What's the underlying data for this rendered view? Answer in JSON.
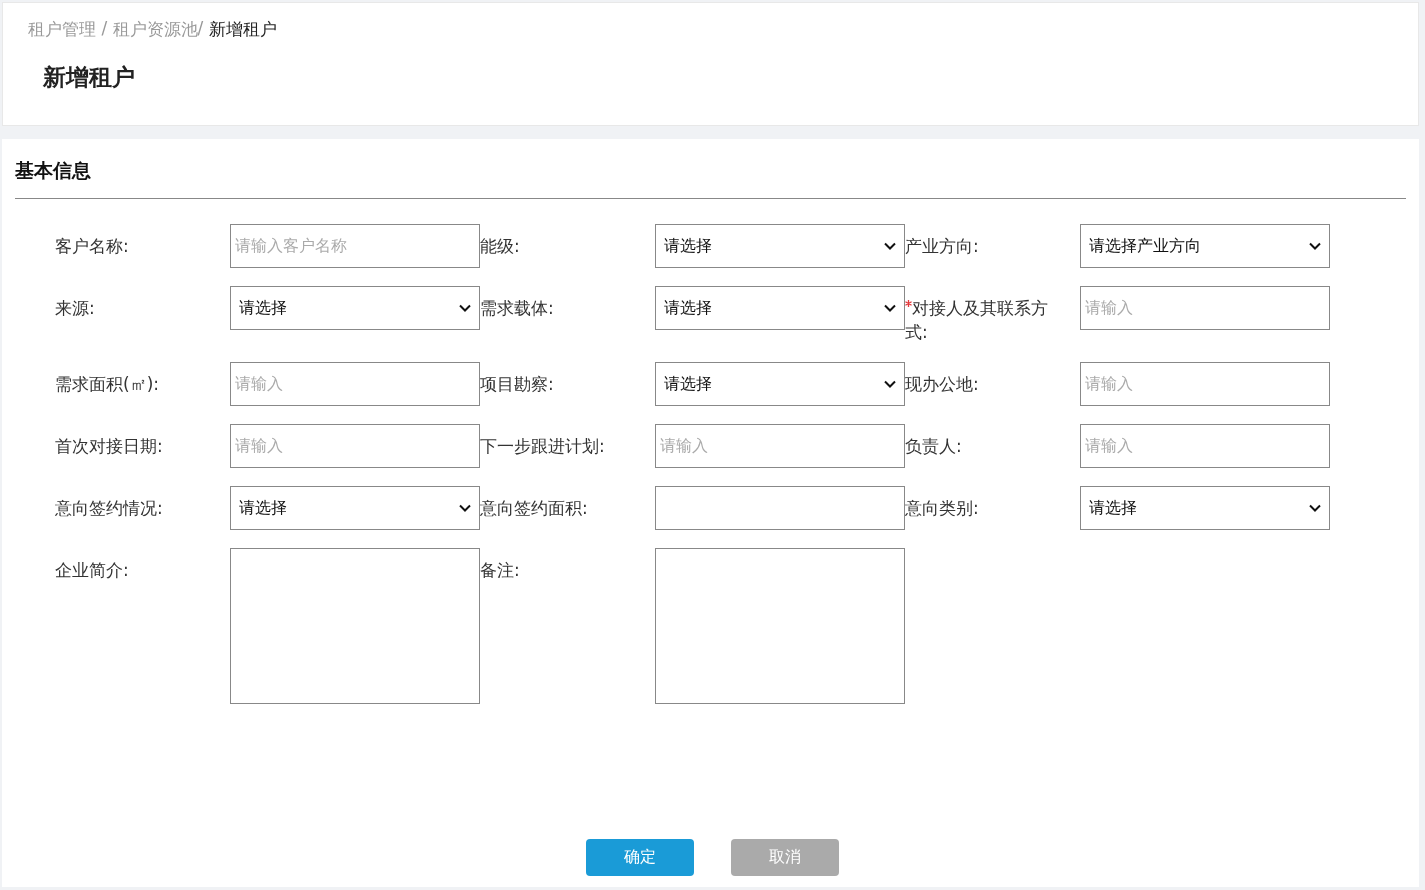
{
  "breadcrumb": [
    {
      "label": "租户管理",
      "separator": " / ",
      "current": false
    },
    {
      "label": "租户资源池",
      "separator": "/ ",
      "current": false
    },
    {
      "label": "新增租户",
      "current": true
    }
  ],
  "page_title": "新增租户",
  "section_title": "基本信息",
  "fields": [
    {
      "kind": "text",
      "label": "客户名称:",
      "required": false,
      "placeholder": "请输入客户名称"
    },
    {
      "kind": "select",
      "label": "能级:",
      "required": false,
      "value": "请选择"
    },
    {
      "kind": "select",
      "label": "产业方向:",
      "required": false,
      "value": "请选择产业方向"
    },
    {
      "kind": "select",
      "label": "来源:",
      "required": false,
      "value": "请选择"
    },
    {
      "kind": "select",
      "label": "需求载体:",
      "required": false,
      "value": "请选择"
    },
    {
      "kind": "text",
      "label": "对接人及其联系方式:",
      "required": true,
      "placeholder": "请输入"
    },
    {
      "kind": "text",
      "label": "需求面积(㎡):",
      "required": false,
      "placeholder": "请输入"
    },
    {
      "kind": "select",
      "label": "项目勘察:",
      "required": false,
      "value": "请选择"
    },
    {
      "kind": "text",
      "label": "现办公地:",
      "required": false,
      "placeholder": "请输入"
    },
    {
      "kind": "text",
      "label": "首次对接日期:",
      "required": false,
      "placeholder": "请输入"
    },
    {
      "kind": "text",
      "label": "下一步跟进计划:",
      "required": false,
      "placeholder": "请输入"
    },
    {
      "kind": "text",
      "label": "负责人:",
      "required": false,
      "placeholder": "请输入"
    },
    {
      "kind": "select",
      "label": "意向签约情况:",
      "required": false,
      "value": "请选择"
    },
    {
      "kind": "text",
      "label": "意向签约面积:",
      "required": false
    },
    {
      "kind": "select",
      "label": "意向类别:",
      "required": false,
      "value": "请选择"
    },
    {
      "kind": "textarea",
      "label": "企业简介:",
      "required": false
    },
    {
      "kind": "textarea",
      "label": "备注:",
      "required": false
    }
  ],
  "buttons": [
    {
      "label": "确定",
      "kind": "primary"
    },
    {
      "label": "取消",
      "kind": "secondary"
    }
  ]
}
